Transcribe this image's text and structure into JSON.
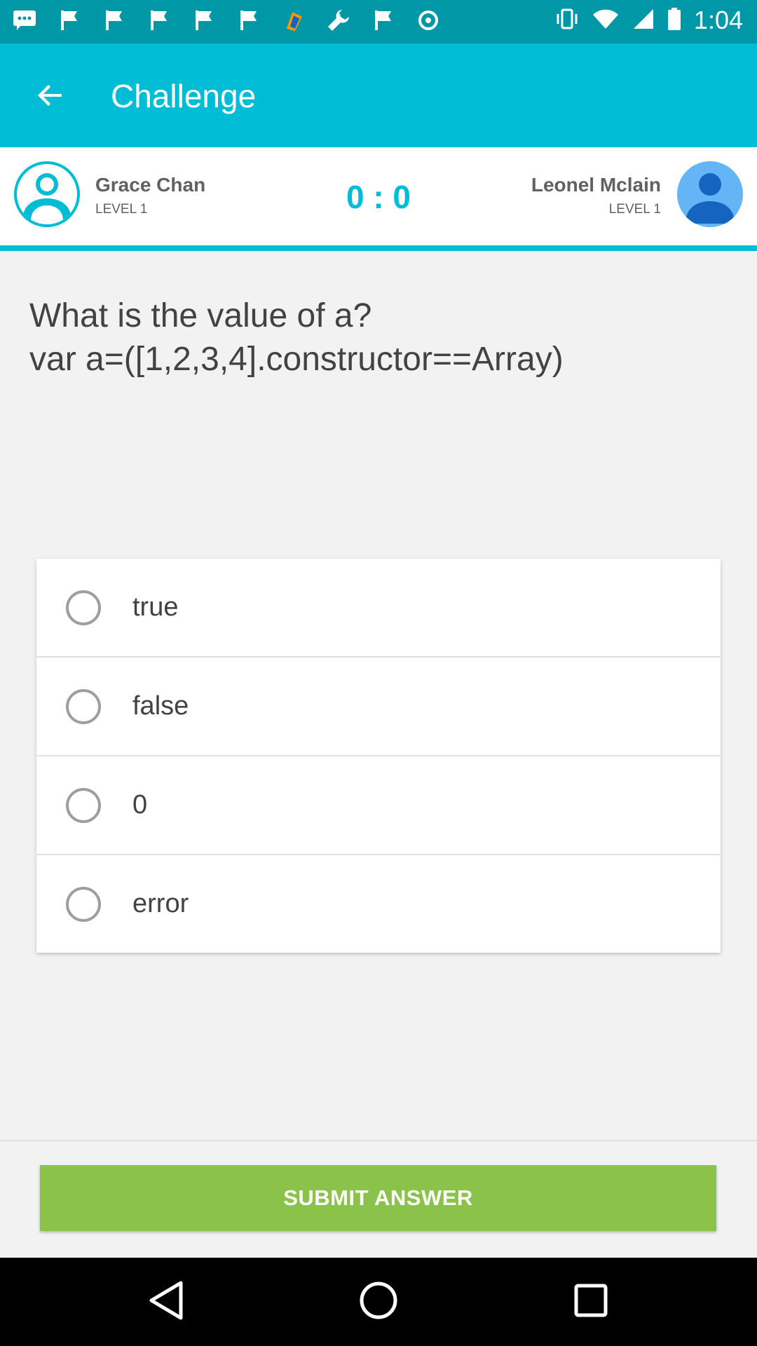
{
  "status_bar": {
    "time": "1:04",
    "left_icons": [
      "chat-icon",
      "flag-icon",
      "flag-icon",
      "flag-icon",
      "flag-icon",
      "flag-icon",
      "app-icon",
      "wrench-icon",
      "flag-icon",
      "gear-icon"
    ],
    "right_icons": [
      "vibrate-icon",
      "wifi-icon",
      "signal-icon",
      "battery-icon"
    ]
  },
  "appbar": {
    "title": "Challenge",
    "back_icon": "arrow-back-icon"
  },
  "players": {
    "left": {
      "name": "Grace Chan",
      "level": "LEVEL 1"
    },
    "right": {
      "name": "Leonel Mclain",
      "level": "LEVEL 1"
    },
    "score": "0 : 0"
  },
  "question": {
    "line1": "What is the value of a?",
    "line2": "var a=([1,2,3,4].constructor==Array)"
  },
  "options": [
    {
      "label": "true"
    },
    {
      "label": "false"
    },
    {
      "label": "0"
    },
    {
      "label": "error"
    }
  ],
  "submit": {
    "label": "SUBMIT ANSWER"
  },
  "colors": {
    "primary": "#00bcd4",
    "primary_dark": "#0097a7",
    "accent_green": "#8bc34a",
    "avatar_blue": "#64b5f6"
  }
}
